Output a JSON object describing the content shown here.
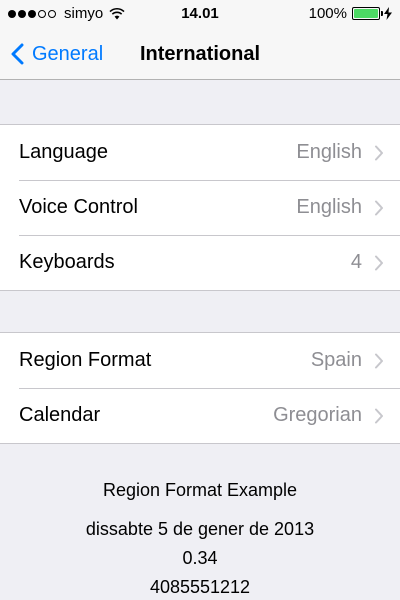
{
  "status_bar": {
    "carrier": "simyo",
    "signal_bars_filled": 3,
    "signal_bars_total": 5,
    "time": "14.01",
    "battery_percent_label": "100%",
    "battery_level": 1.0,
    "wifi_icon": "wifi-icon",
    "charging_icon": "bolt-icon"
  },
  "nav": {
    "back_label": "General",
    "title": "International"
  },
  "groups": [
    {
      "rows": [
        {
          "label": "Language",
          "value": "English"
        },
        {
          "label": "Voice Control",
          "value": "English"
        },
        {
          "label": "Keyboards",
          "value": "4"
        }
      ]
    },
    {
      "rows": [
        {
          "label": "Region Format",
          "value": "Spain"
        },
        {
          "label": "Calendar",
          "value": "Gregorian"
        }
      ]
    }
  ],
  "example": {
    "title": "Region Format Example",
    "date": "dissabte 5 de gener de 2013",
    "number": "0.34",
    "phone": "4085551212"
  },
  "colors": {
    "accent": "#007aff",
    "secondary_text": "#8e8e93",
    "battery_fill": "#4cd964",
    "background": "#efeff4"
  }
}
